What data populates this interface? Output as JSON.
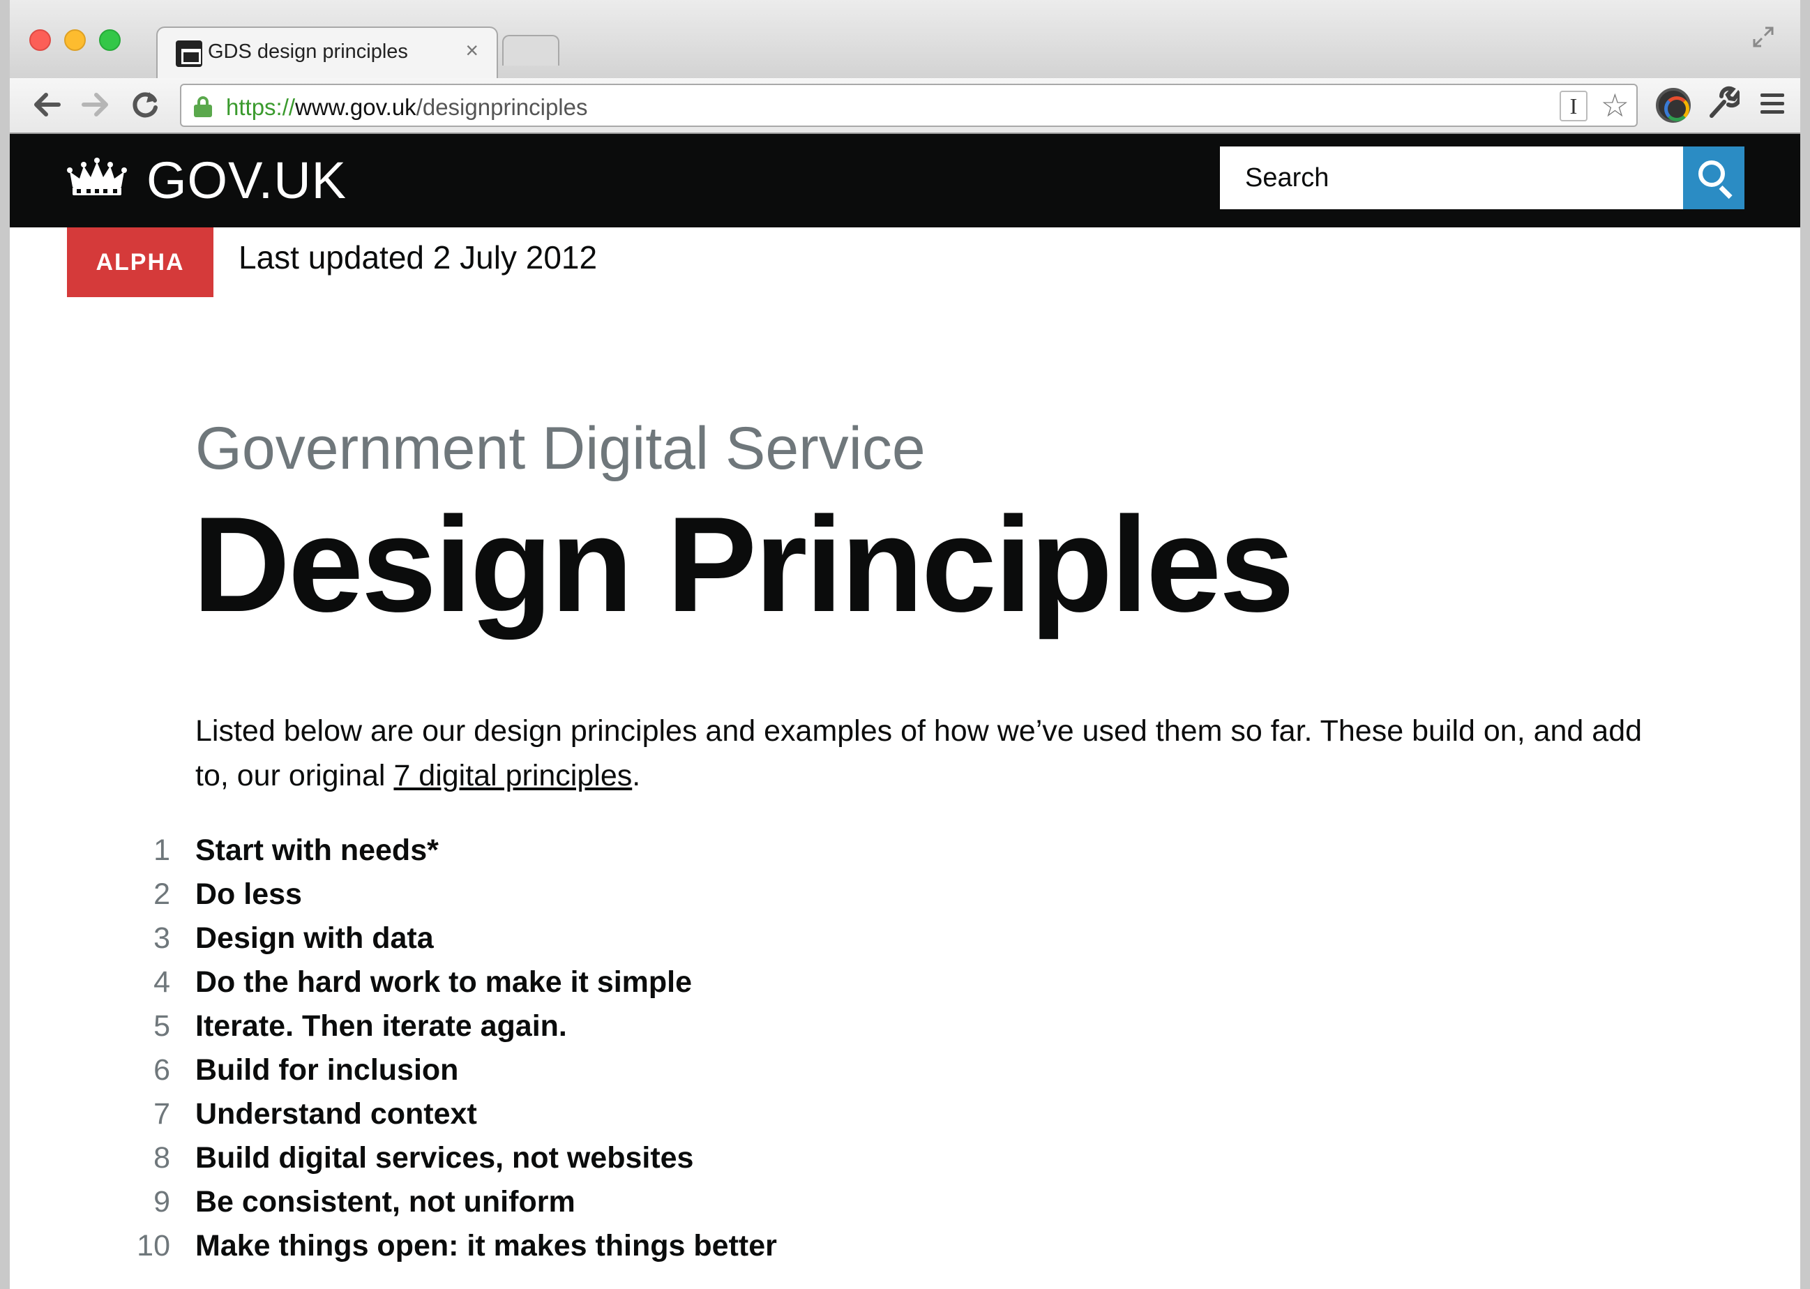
{
  "browser": {
    "tab_title": "GDS design principles",
    "tab_close": "×",
    "url_scheme": "https://",
    "url_host": "www.gov.uk",
    "url_path": "/designprinciples",
    "reader_label": "I"
  },
  "header": {
    "logo_text": "GOV.UK",
    "search_placeholder": "Search",
    "brand_color": "#0b0c0c",
    "search_button_color": "#2b8cc4"
  },
  "phase_banner": {
    "tag": "ALPHA",
    "tag_color": "#d53a3a",
    "last_updated": "Last updated 2 July 2012"
  },
  "main": {
    "subtitle": "Government Digital Service",
    "title": "Design Principles",
    "intro_before_link": "Listed below are our design principles and examples of how we’ve used them so far. These build on, and add to, our original ",
    "intro_link": "7 digital principles",
    "intro_after_link": ".",
    "principles": [
      {
        "num": "1",
        "text": "Start with needs*"
      },
      {
        "num": "2",
        "text": "Do less"
      },
      {
        "num": "3",
        "text": "Design with data"
      },
      {
        "num": "4",
        "text": "Do the hard work to make it simple"
      },
      {
        "num": "5",
        "text": "Iterate. Then iterate again."
      },
      {
        "num": "6",
        "text": "Build for inclusion"
      },
      {
        "num": "7",
        "text": "Understand context"
      },
      {
        "num": "8",
        "text": "Build digital services, not websites"
      },
      {
        "num": "9",
        "text": "Be consistent, not uniform"
      },
      {
        "num": "10",
        "text": "Make things open: it makes things better"
      }
    ]
  }
}
